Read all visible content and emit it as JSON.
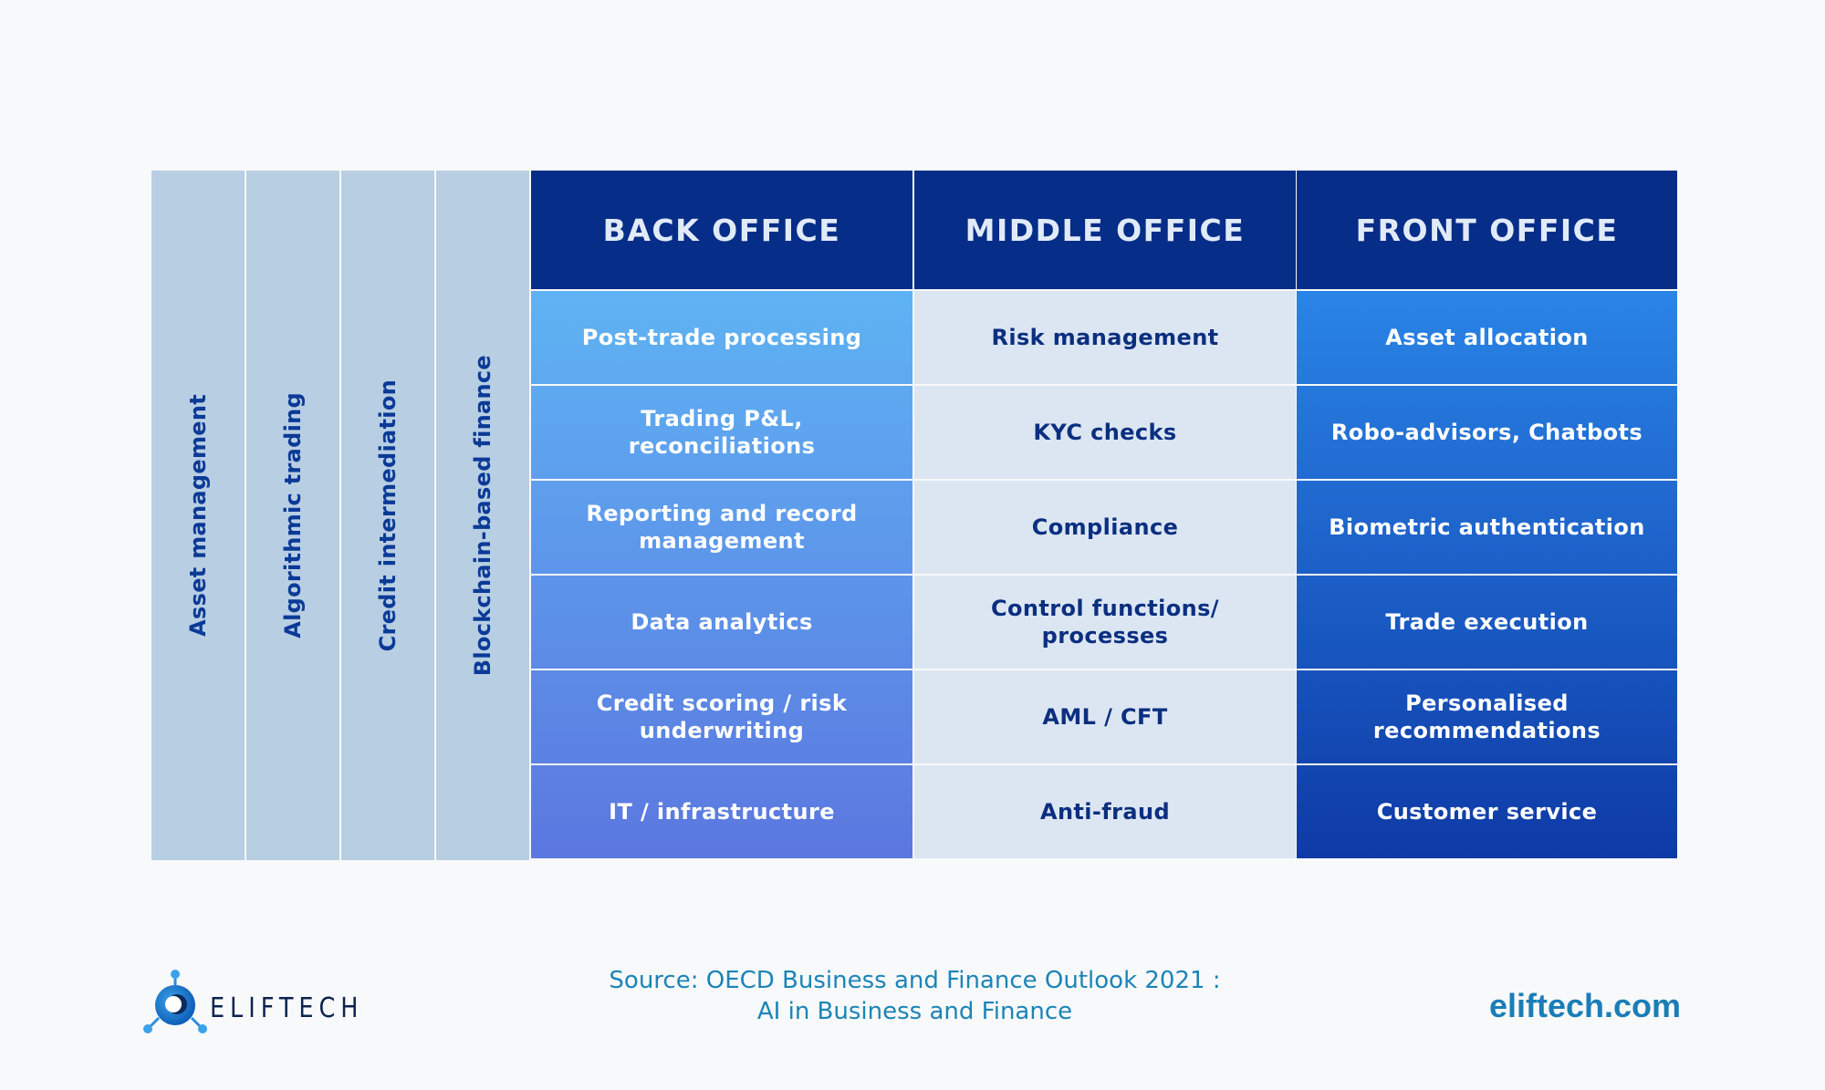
{
  "categories": [
    "Asset management",
    "Algorithmic trading",
    "Credit intermediation",
    "Blockchain-based finance"
  ],
  "columns": [
    {
      "header": "BACK OFFICE",
      "text_tone": "light",
      "gradient": [
        "#5fb3f3",
        "#5b77e0"
      ],
      "items": [
        "Post-trade processing",
        "Trading P&L, reconciliations",
        "Reporting and record management",
        "Data analytics",
        "Credit scoring / risk underwriting",
        "IT / infrastructure"
      ]
    },
    {
      "header": "MIDDLE OFFICE",
      "text_tone": "dark",
      "gradient": [
        "#dce6f2",
        "#dce6f2"
      ],
      "items": [
        "Risk management",
        "KYC checks",
        "Compliance",
        "Control functions/ processes",
        "AML / CFT",
        "Anti-fraud"
      ]
    },
    {
      "header": "FRONT OFFICE",
      "text_tone": "light",
      "gradient": [
        "#2a84e7",
        "#0e3aa6"
      ],
      "items": [
        "Asset allocation",
        "Robo-advisors, Chatbots",
        "Biometric authentication",
        "Trade execution",
        "Personalised recommendations",
        "Customer service"
      ]
    }
  ],
  "footer": {
    "logo_text": "ELIFTECH",
    "source_line1": "Source: OECD Business and Finance Outlook 2021 :",
    "source_line2": "AI in Business and Finance",
    "website": "eliftech.com"
  }
}
